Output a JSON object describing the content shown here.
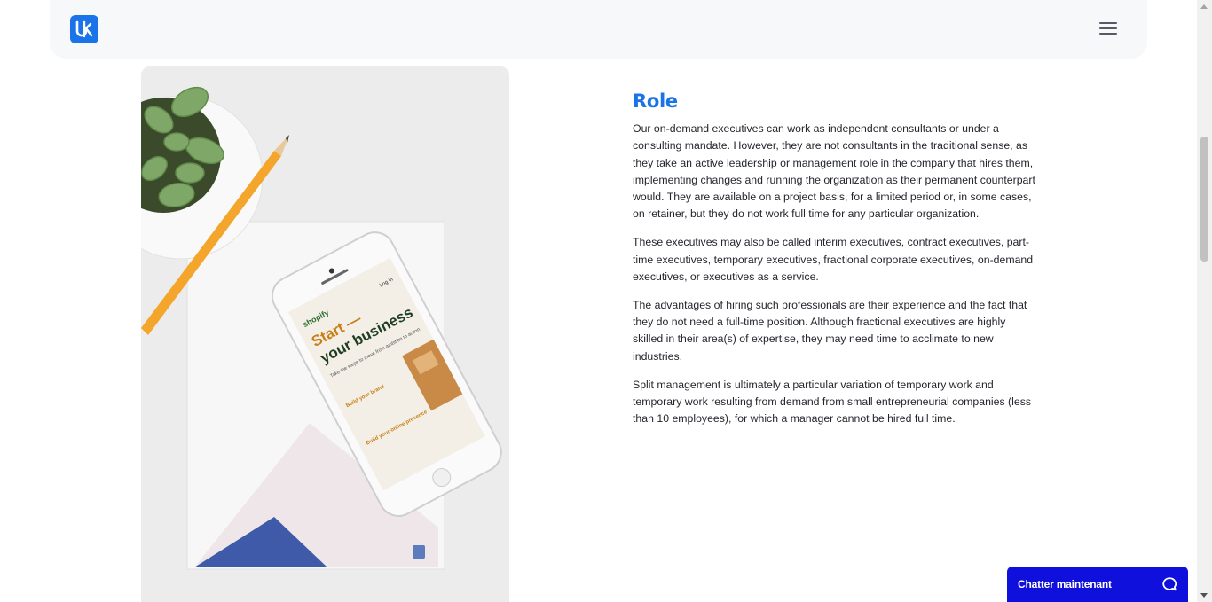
{
  "header": {
    "logo_icon": "uk-logo-icon",
    "menu_icon": "hamburger-menu-icon",
    "accent": "#1a73e8",
    "background": "#f7f8fa"
  },
  "hero_image": {
    "phone_brand": "shopify",
    "phone_headline_1": "Start —",
    "phone_headline_2": "your business",
    "phone_subtitle": "Take the steps to move from ambition to action.",
    "phone_login": "Log in",
    "phone_step_1": "Build your brand",
    "phone_step_2": "Build your online presence"
  },
  "section": {
    "title": "Role",
    "paragraphs": [
      "Our on-demand executives can work as independent consultants or under a consulting mandate. However, they are not consultants in the traditional sense, as they take an active leadership or management role in the company that hires them, implementing changes and running the organization as their permanent counterpart would. They are available on a project basis, for a limited period or, in some cases, on retainer, but they do not work full time for any particular organization.",
      "These executives may also be called interim executives, contract executives, part-time executives, temporary executives, fractional corporate executives, on-demand executives, or executives as a service.",
      "The advantages of hiring such professionals are their experience and the fact that they do not need a full-time position. Although fractional executives are highly skilled in their area(s) of expertise, they may need time to acclimate to new industries.",
      "Split management is ultimately a particular variation of temporary work and temporary work resulting from demand from small entrepreneurial companies (less than 10 employees), for which a manager cannot be hired full time."
    ]
  },
  "chat": {
    "label": "Chatter maintenant",
    "icon": "chat-bubble-icon",
    "color": "#1010dd"
  }
}
